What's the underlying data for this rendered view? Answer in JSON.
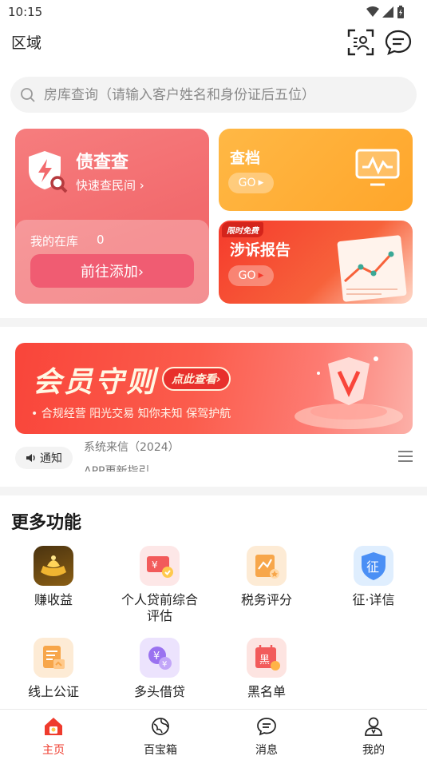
{
  "status_bar": {
    "time": "10:15"
  },
  "header": {
    "title": "区域"
  },
  "search": {
    "placeholder": "房库查询（请输入客户姓名和身份证后五位）"
  },
  "debt_card": {
    "title": "债查查",
    "subtitle": "快速查民间",
    "stock_label": "我的在库",
    "stock_count": "0",
    "add_button": "前往添加"
  },
  "archive_card": {
    "title": "查档",
    "go_label": "GO"
  },
  "lawsuit_card": {
    "badge": "限时免费",
    "title": "涉诉报告",
    "go_label": "GO"
  },
  "member_banner": {
    "title": "会员守则",
    "check_button": "点此查看",
    "slogan": "合规经营 阳光交易 知你未知 保驾护航"
  },
  "notice": {
    "tag": "通知",
    "lines": [
      "系统来信（2024）",
      "APP更新指引"
    ]
  },
  "more_functions": {
    "title": "更多功能",
    "items": [
      {
        "label": "赚收益"
      },
      {
        "label": "个人贷前综合评估"
      },
      {
        "label": "税务评分"
      },
      {
        "label": "征·详信"
      },
      {
        "label": "线上公证"
      },
      {
        "label": "多头借贷"
      },
      {
        "label": "黑名单"
      }
    ]
  },
  "bottom_nav": {
    "items": [
      {
        "label": "主页",
        "icon": "home-icon",
        "active": true
      },
      {
        "label": "百宝箱",
        "icon": "toolbox-icon"
      },
      {
        "label": "消息",
        "icon": "message-icon"
      },
      {
        "label": "我的",
        "icon": "profile-icon"
      }
    ]
  },
  "colors": {
    "accent": "#ef3b2d",
    "debt_card": "#f26a6d",
    "archive_card": "#ffa62b",
    "lawsuit_card": "#f53a2c"
  }
}
